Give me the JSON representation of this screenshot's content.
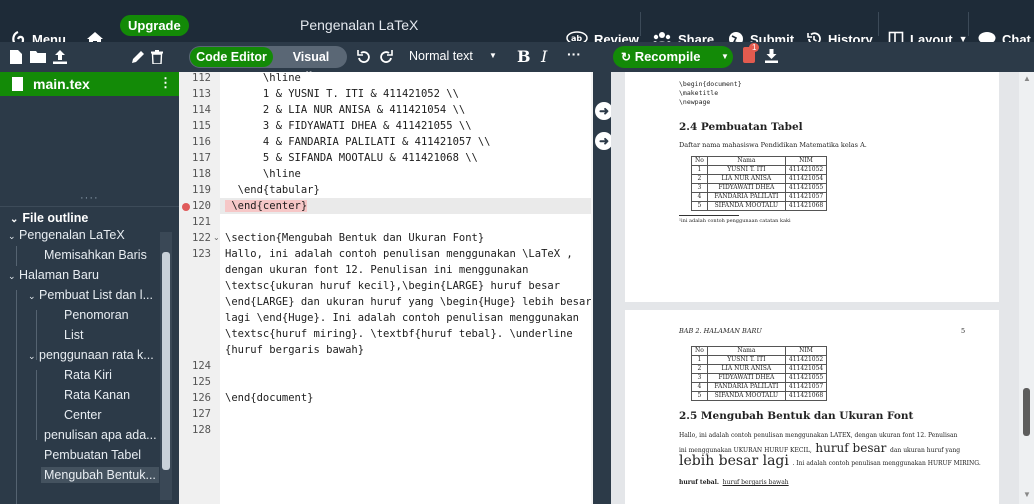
{
  "topbar": {
    "menu": "Menu",
    "upgrade": "Upgrade",
    "title": "Pengenalan LaTeX",
    "review": "Review",
    "share": "Share",
    "submit": "Submit",
    "history": "History",
    "layout": "Layout",
    "chat": "Chat"
  },
  "sidebar": {
    "active_file": "main.tex",
    "outline_title": "File outline",
    "outline": [
      "Pengenalan LaTeX",
      "Memisahkan Baris",
      "Halaman Baru",
      "Pembuat List dan l...",
      "Penomoran",
      "List",
      "penggunaan rata k...",
      "Rata Kiri",
      "Rata Kanan",
      "Center",
      "penulisan apa ada...",
      "Pembuatan Tabel",
      "Mengubah Bentuk..."
    ]
  },
  "editor": {
    "mode_code": "Code Editor",
    "mode_visual": "Visual Editor",
    "style_select": "Normal text",
    "bold": "B",
    "italic": "I",
    "more": "···",
    "line_numbers": [
      "112",
      "113",
      "114",
      "115",
      "116",
      "117",
      "118",
      "119",
      "120",
      "121",
      "122",
      "123",
      "124",
      "125",
      "126",
      "127",
      "128"
    ],
    "lines": [
      "      \\hline",
      "      1 & YUSNI T. ITI & 411421052 \\\\",
      "      2 & LIA NUR ANISA & 411421054 \\\\",
      "      3 & FIDYAWATI DHEA & 411421055 \\\\",
      "      4 & FANDARIA PALILATI & 411421057 \\\\",
      "      5 & SIFANDA MOOTALU & 411421068 \\\\",
      "      \\hline",
      "  \\end{tabular}",
      " \\end{center}",
      "",
      "\\section{Mengubah Bentuk dan Ukuran Font}",
      "Hallo, ini adalah contoh penulisan menggunakan \\LaTeX ,",
      "dengan ukuran font 12. Penulisan ini menggunakan",
      "\\textsc{ukuran huruf kecil},\\begin{LARGE} huruf besar",
      "\\end{LARGE} dan ukuran huruf yang \\begin{Huge} lebih besar",
      "lagi \\end{Huge}. Ini adalah contoh penulisan menggunakan",
      "\\textsc{huruf miring}. \\textbf{huruf tebal}. \\underline",
      "{huruf bergaris bawah}",
      "",
      "",
      "\\end{document}"
    ]
  },
  "preview": {
    "recompile": "Recompile",
    "pdf_badge": "1",
    "page1": {
      "code_lines": [
        "\\begin{document}",
        "\\maketitle",
        "\\newpage"
      ],
      "section": "2.4   Pembuatan Tabel",
      "intro": "Daftar nama mahasiswa Pendidikan Matematika kelas A.",
      "table_header": [
        "No",
        "Nama",
        "NIM"
      ],
      "table_rows": [
        [
          "1",
          "YUSNI T. ITI",
          "411421052"
        ],
        [
          "2",
          "LIA NUR ANISA",
          "411421054"
        ],
        [
          "3",
          "FIDYAWATI DHEA",
          "411421055"
        ],
        [
          "4",
          "FANDARIA PALILATI",
          "411421057"
        ],
        [
          "5",
          "SIFANDA MOOTALU",
          "411421068"
        ]
      ],
      "footnote": "¹ini adalah contoh penggunaan catatan kaki"
    },
    "page2": {
      "running_head": "BAB 2.  HALAMAN BARU",
      "page_number": "5",
      "section": "2.5   Mengubah Bentuk dan Ukuran Font",
      "para_line1": "Hallo, ini adalah contoh penulisan menggunakan LATEX, dengan ukuran font 12. Penulisan",
      "para_line2a": "ini menggunakan UKURAN HURUF KECIL,",
      "para_line2b": "huruf besar",
      "para_line2c": "dan ukuran huruf yang",
      "para_line3a": "lebih besar lagi",
      "para_line3b": ". Ini adalah contoh penulisan menggunakan HURUF MIRING.",
      "para_line4a": "huruf tebal.",
      "para_line4b": "huruf bergaris bawah"
    }
  }
}
